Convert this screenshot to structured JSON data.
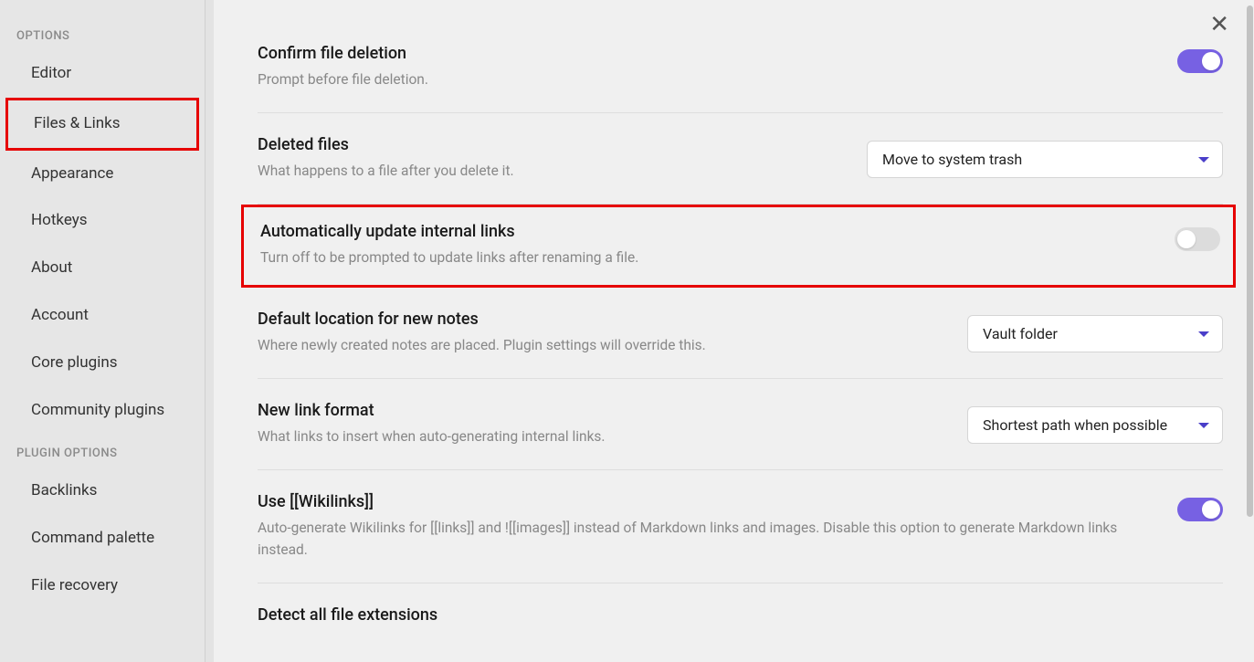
{
  "sidebar": {
    "sections": [
      {
        "title": "OPTIONS",
        "items": [
          {
            "label": "Editor",
            "selected": false
          },
          {
            "label": "Files & Links",
            "selected": true
          },
          {
            "label": "Appearance",
            "selected": false
          },
          {
            "label": "Hotkeys",
            "selected": false
          },
          {
            "label": "About",
            "selected": false
          },
          {
            "label": "Account",
            "selected": false
          },
          {
            "label": "Core plugins",
            "selected": false
          },
          {
            "label": "Community plugins",
            "selected": false
          }
        ]
      },
      {
        "title": "PLUGIN OPTIONS",
        "items": [
          {
            "label": "Backlinks",
            "selected": false
          },
          {
            "label": "Command palette",
            "selected": false
          },
          {
            "label": "File recovery",
            "selected": false
          }
        ]
      }
    ]
  },
  "settings": {
    "confirm_delete": {
      "title": "Confirm file deletion",
      "desc": "Prompt before file deletion.",
      "toggle": true
    },
    "deleted_files": {
      "title": "Deleted files",
      "desc": "What happens to a file after you delete it.",
      "value": "Move to system trash"
    },
    "auto_update_links": {
      "title": "Automatically update internal links",
      "desc": "Turn off to be prompted to update links after renaming a file.",
      "toggle": false
    },
    "default_location": {
      "title": "Default location for new notes",
      "desc": "Where newly created notes are placed. Plugin settings will override this.",
      "value": "Vault folder"
    },
    "new_link_format": {
      "title": "New link format",
      "desc": "What links to insert when auto-generating internal links.",
      "value": "Shortest path when possible"
    },
    "use_wikilinks": {
      "title": "Use [[Wikilinks]]",
      "desc": "Auto-generate Wikilinks for [[links]] and ![[images]] instead of Markdown links and images. Disable this option to generate Markdown links instead.",
      "toggle": true
    },
    "detect_extensions": {
      "title": "Detect all file extensions"
    }
  },
  "colors": {
    "accent": "#7761e3",
    "highlight_border": "#e60000"
  }
}
